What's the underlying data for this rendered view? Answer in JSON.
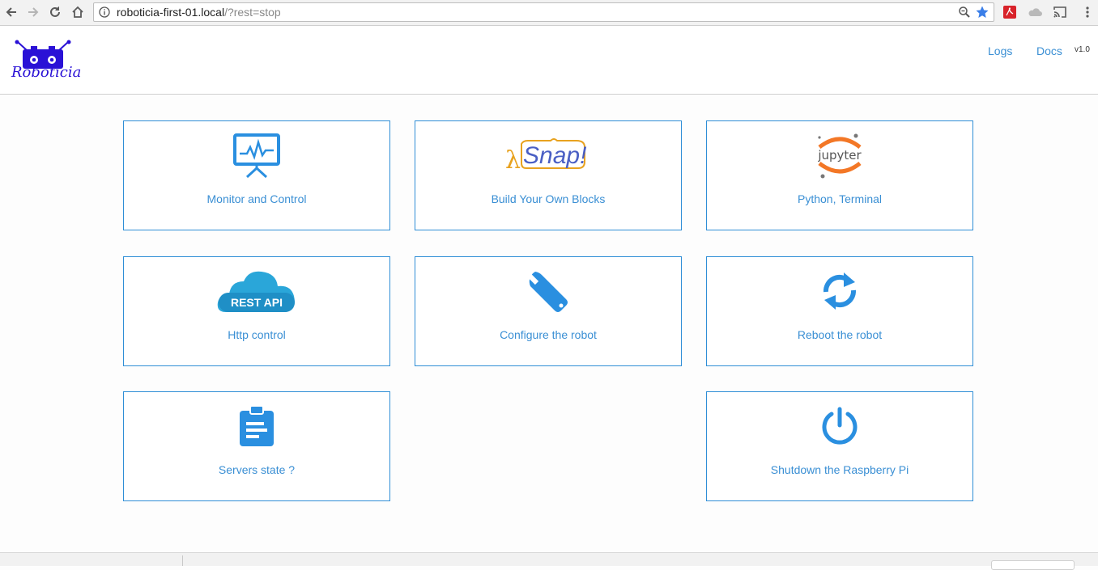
{
  "browser": {
    "url_host": "roboticia-first-01.local",
    "url_path": "/?rest=stop"
  },
  "header": {
    "logo_text": "Roboticia",
    "links": [
      {
        "label": "Logs"
      },
      {
        "label": "Docs"
      }
    ],
    "version": "v1.0"
  },
  "cards": [
    {
      "label": "Monitor and Control",
      "icon": "monitor-chart-icon"
    },
    {
      "label": "Build Your Own Blocks",
      "icon": "snap-logo-icon",
      "icon_text": "Snap!"
    },
    {
      "label": "Python, Terminal",
      "icon": "jupyter-logo-icon",
      "icon_text": "jupyter"
    },
    {
      "label": "Http control",
      "icon": "rest-api-cloud-icon",
      "icon_text": "REST API"
    },
    {
      "label": "Configure the robot",
      "icon": "wrench-icon"
    },
    {
      "label": "Reboot the robot",
      "icon": "refresh-icon"
    },
    {
      "label": "Servers state ?",
      "icon": "clipboard-icon"
    },
    {
      "label": "Shutdown the Raspberry Pi",
      "icon": "power-icon"
    }
  ],
  "colors": {
    "accent": "#3a8fd4",
    "card_border": "#2f8ed6",
    "logo": "#2a11d6",
    "snap_orange": "#e8a21f",
    "snap_blue": "#4a5fc4",
    "jupyter_orange": "#f37726",
    "cloud_blue": "#2aa6d9"
  }
}
